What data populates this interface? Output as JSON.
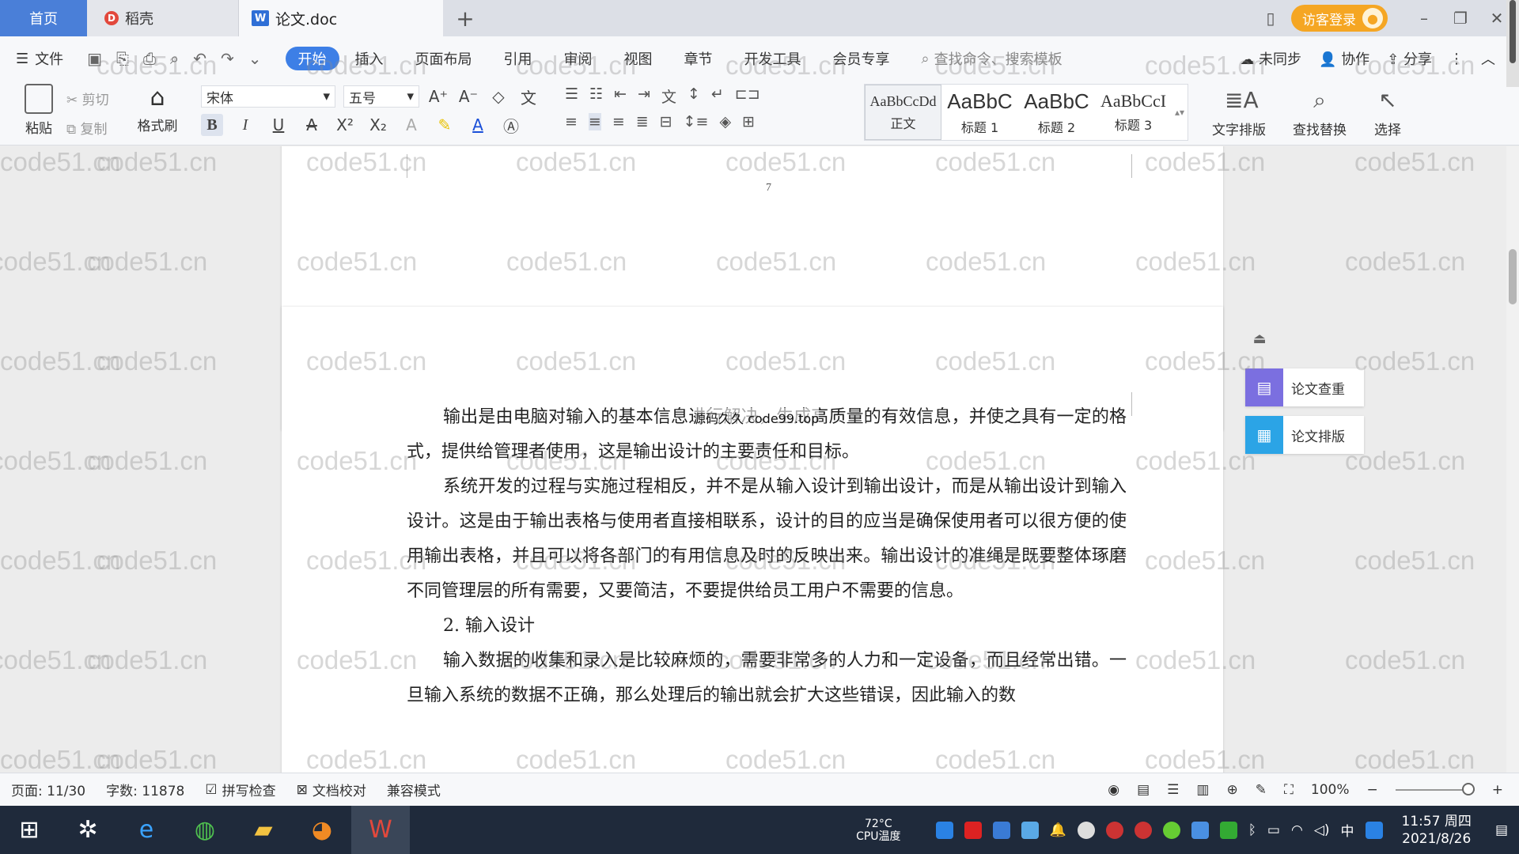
{
  "tabs": {
    "home": "首页",
    "shell": "稻壳",
    "document": "论文.doc",
    "add": "+"
  },
  "guest_login": "访客登录",
  "menu": {
    "file": "文件",
    "tabs": [
      "开始",
      "插入",
      "页面布局",
      "引用",
      "审阅",
      "视图",
      "章节",
      "开发工具",
      "会员专享"
    ],
    "search_placeholder": "查找命令、搜索模板",
    "sync": "未同步",
    "collaborate": "协作",
    "share": "分享"
  },
  "ribbon": {
    "paste": "粘贴",
    "cut": "剪切",
    "copy": "复制",
    "format_painter": "格式刷",
    "font_name": "宋体",
    "font_size": "五号",
    "styles": [
      {
        "preview": "AaBbCcDd",
        "name": "正文"
      },
      {
        "preview": "AaBbC",
        "name": "标题 1"
      },
      {
        "preview": "AaBbC",
        "name": "标题 2"
      },
      {
        "preview": "AaBbCcI",
        "name": "标题 3"
      }
    ],
    "text_layout": "文字排版",
    "find_replace": "查找替换",
    "select": "选择"
  },
  "document": {
    "page_number": "7",
    "overlay_label": "源码久久 code99.top",
    "paragraphs": [
      "输出是由电脑对输入的基本信息进行解决，生成高质量的有效信息，并使之具有一定的格式，提供给管理者使用，这是输出设计的主要责任和目标。",
      "系统开发的过程与实施过程相反，并不是从输入设计到输出设计，而是从输出设计到输入设计。这是由于输出表格与使用者直接相联系，设计的目的应当是确保使用者可以很方便的使用输出表格，并且可以将各部门的有用信息及时的反映出来。输出设计的准绳是既要整体琢磨不同管理层的所有需要，又要简洁，不要提供给员工用户不需要的信息。",
      "2. 输入设计",
      "输入数据的收集和录入是比较麻烦的，需要非常多的人力和一定设备，而且经常出错。一旦输入系统的数据不正确，那么处理后的输出就会扩大这些错误，因此输入的数"
    ]
  },
  "side_panel": {
    "check": "论文查重",
    "layout": "论文排版"
  },
  "status": {
    "page": "页面: 11/30",
    "words": "字数: 11878",
    "spell": "拼写检查",
    "proof": "文档校对",
    "compat": "兼容模式",
    "zoom": "100%",
    "zoom_level": 0.92
  },
  "watermark": "code51.cn",
  "taskbar": {
    "temp": "72°C",
    "cpu": "CPU温度",
    "ime": "中",
    "time": "11:57 周四",
    "date": "2021/8/26"
  }
}
